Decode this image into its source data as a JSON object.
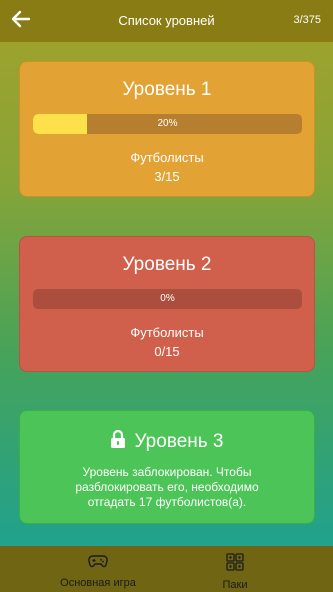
{
  "header": {
    "title": "Список уровней",
    "counter": "3/375"
  },
  "levels": [
    {
      "title": "Уровень 1",
      "progress_label": "20%",
      "progress_fraction": 0.2,
      "players_label": "Футболисты",
      "players_count": "3/15",
      "color": "#e2a234"
    },
    {
      "title": "Уровень 2",
      "progress_label": "0%",
      "progress_fraction": 0,
      "players_label": "Футболисты",
      "players_count": "0/15",
      "color": "#d0604b"
    },
    {
      "title": "Уровень 3",
      "locked": true,
      "locked_text": "Уровень заблокирован. Чтобы разблокировать его, необходимо отгадать 17 футболистов(а).",
      "color": "#4cc457"
    }
  ],
  "bottom_nav": {
    "main_game_label": "Основная игра",
    "packs_label": "Паки"
  },
  "colors": {
    "topbar": "#8a7c14",
    "bottombar": "#6f6512",
    "progress_fill": "#fde14b"
  }
}
